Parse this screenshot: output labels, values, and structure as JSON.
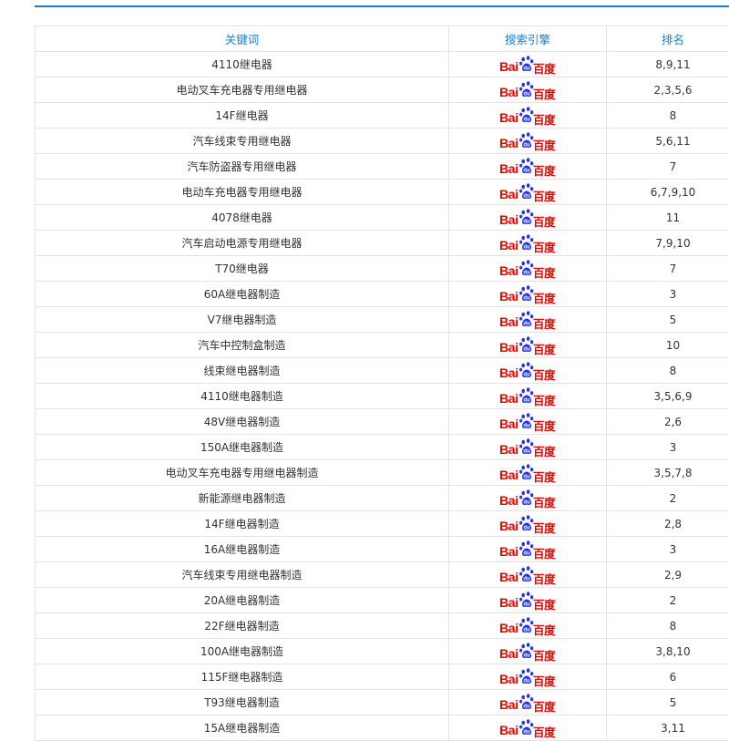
{
  "table": {
    "headers": {
      "keyword": "关键词",
      "engine": "搜索引擎",
      "rank": "排名"
    },
    "engine_logo": {
      "bai": "Bai",
      "du": "百度",
      "icon": "baidu-paw-icon",
      "color": "#e10602"
    },
    "rows": [
      {
        "keyword": "4110继电器",
        "rank": "8,9,11"
      },
      {
        "keyword": "电动叉车充电器专用继电器",
        "rank": "2,3,5,6"
      },
      {
        "keyword": "14F继电器",
        "rank": "8"
      },
      {
        "keyword": "汽车线束专用继电器",
        "rank": "5,6,11"
      },
      {
        "keyword": "汽车防盗器专用继电器",
        "rank": "7"
      },
      {
        "keyword": "电动车充电器专用继电器",
        "rank": "6,7,9,10"
      },
      {
        "keyword": "4078继电器",
        "rank": "11"
      },
      {
        "keyword": "汽车启动电源专用继电器",
        "rank": "7,9,10"
      },
      {
        "keyword": "T70继电器",
        "rank": "7"
      },
      {
        "keyword": "60A继电器制造",
        "rank": "3"
      },
      {
        "keyword": "V7继电器制造",
        "rank": "5"
      },
      {
        "keyword": "汽车中控制盒制造",
        "rank": "10"
      },
      {
        "keyword": "线束继电器制造",
        "rank": "8"
      },
      {
        "keyword": "4110继电器制造",
        "rank": "3,5,6,9"
      },
      {
        "keyword": "48V继电器制造",
        "rank": "2,6"
      },
      {
        "keyword": "150A继电器制造",
        "rank": "3"
      },
      {
        "keyword": "电动叉车充电器专用继电器制造",
        "rank": "3,5,7,8"
      },
      {
        "keyword": "新能源继电器制造",
        "rank": "2"
      },
      {
        "keyword": "14F继电器制造",
        "rank": "2,8"
      },
      {
        "keyword": "16A继电器制造",
        "rank": "3"
      },
      {
        "keyword": "汽车线束专用继电器制造",
        "rank": "2,9"
      },
      {
        "keyword": "20A继电器制造",
        "rank": "2"
      },
      {
        "keyword": "22F继电器制造",
        "rank": "8"
      },
      {
        "keyword": "100A继电器制造",
        "rank": "3,8,10"
      },
      {
        "keyword": "115F继电器制造",
        "rank": "6"
      },
      {
        "keyword": "T93继电器制造",
        "rank": "5"
      },
      {
        "keyword": "15A继电器制造",
        "rank": "3,11"
      }
    ]
  }
}
